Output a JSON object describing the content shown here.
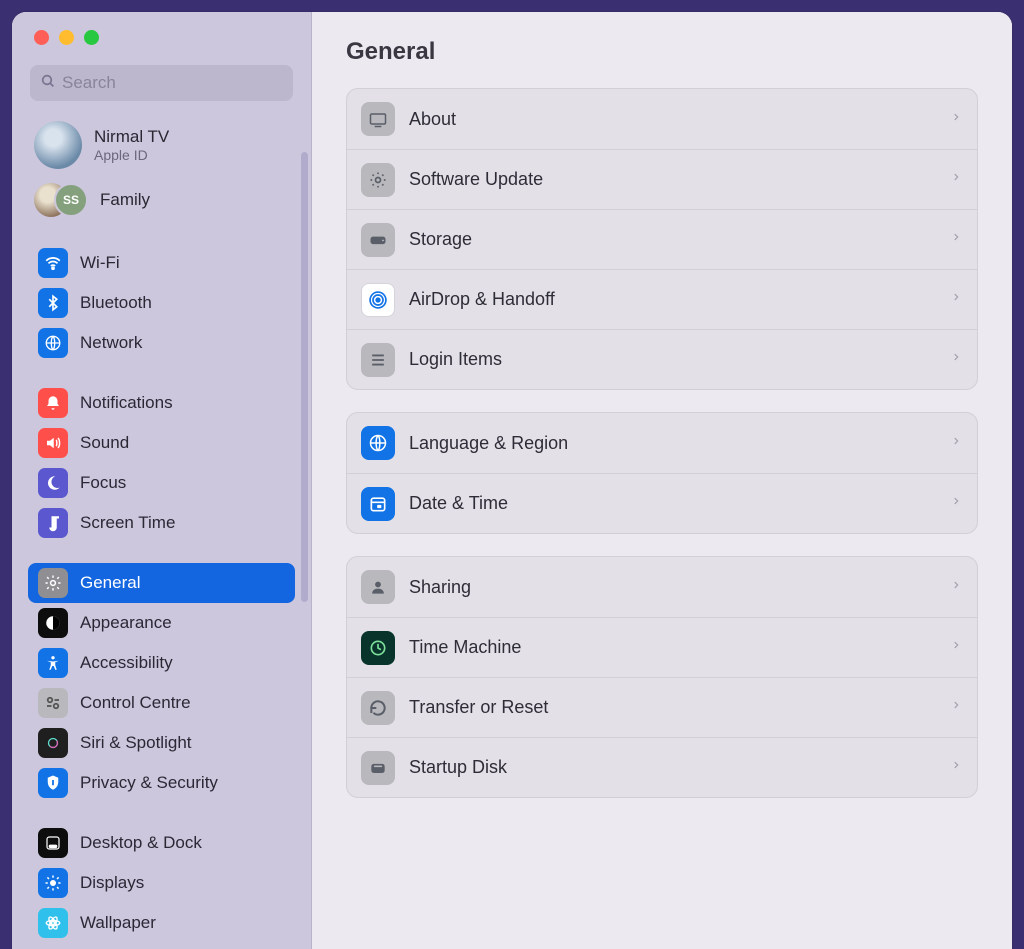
{
  "search": {
    "placeholder": "Search"
  },
  "account": {
    "name": "Nirmal TV",
    "sub": "Apple ID"
  },
  "family": {
    "label": "Family",
    "badge": "SS"
  },
  "sidebar": {
    "groups": [
      [
        {
          "id": "wifi",
          "label": "Wi-Fi",
          "bg": "#1173e6"
        },
        {
          "id": "bluetooth",
          "label": "Bluetooth",
          "bg": "#1173e6"
        },
        {
          "id": "network",
          "label": "Network",
          "bg": "#1173e6"
        }
      ],
      [
        {
          "id": "notifications",
          "label": "Notifications",
          "bg": "#ff4f4b"
        },
        {
          "id": "sound",
          "label": "Sound",
          "bg": "#ff4f4b"
        },
        {
          "id": "focus",
          "label": "Focus",
          "bg": "#5b57cf"
        },
        {
          "id": "screentime",
          "label": "Screen Time",
          "bg": "#5b57cf"
        }
      ],
      [
        {
          "id": "general",
          "label": "General",
          "bg": "#8e8e93",
          "selected": true
        },
        {
          "id": "appearance",
          "label": "Appearance",
          "bg": "#0d0d0d"
        },
        {
          "id": "accessibility",
          "label": "Accessibility",
          "bg": "#1173e6"
        },
        {
          "id": "controlcentre",
          "label": "Control Centre",
          "bg": "#b8b8bd"
        },
        {
          "id": "siri",
          "label": "Siri & Spotlight",
          "bg": "#1f1f1f"
        },
        {
          "id": "privacy",
          "label": "Privacy & Security",
          "bg": "#1173e6"
        }
      ],
      [
        {
          "id": "desktopdock",
          "label": "Desktop & Dock",
          "bg": "#0d0d0d"
        },
        {
          "id": "displays",
          "label": "Displays",
          "bg": "#1173e6"
        },
        {
          "id": "wallpaper",
          "label": "Wallpaper",
          "bg": "#2fc0ec"
        }
      ]
    ]
  },
  "main": {
    "title": "General",
    "sections": [
      [
        {
          "id": "about",
          "label": "About",
          "bg": "#b8b8bd"
        },
        {
          "id": "swupdate",
          "label": "Software Update",
          "bg": "#b8b8bd"
        },
        {
          "id": "storage",
          "label": "Storage",
          "bg": "#b8b8bd"
        },
        {
          "id": "airdrop",
          "label": "AirDrop & Handoff",
          "bg": "#ffffff"
        },
        {
          "id": "login",
          "label": "Login Items",
          "bg": "#b8b8bd"
        }
      ],
      [
        {
          "id": "language",
          "label": "Language & Region",
          "bg": "#1173e6"
        },
        {
          "id": "datetime",
          "label": "Date & Time",
          "bg": "#1173e6"
        }
      ],
      [
        {
          "id": "sharing",
          "label": "Sharing",
          "bg": "#b8b8bd"
        },
        {
          "id": "timemach",
          "label": "Time Machine",
          "bg": "#09342c"
        },
        {
          "id": "transfer",
          "label": "Transfer or Reset",
          "bg": "#b8b8bd"
        },
        {
          "id": "startup",
          "label": "Startup Disk",
          "bg": "#b8b8bd"
        }
      ]
    ]
  }
}
